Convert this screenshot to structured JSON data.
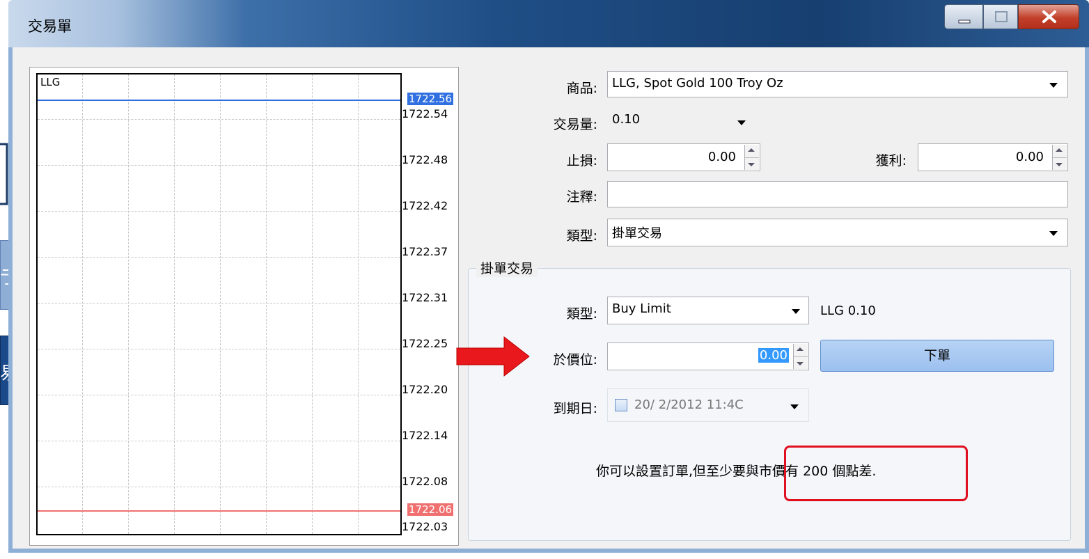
{
  "window": {
    "title": "交易單"
  },
  "slide_fragments": {
    "frag1": "亍",
    "frag2": "易"
  },
  "chart": {
    "symbol": "LLG",
    "ticks": [
      "1722.54",
      "1722.48",
      "1722.42",
      "1722.37",
      "1722.31",
      "1722.25",
      "1722.20",
      "1722.14",
      "1722.08",
      "1722.03"
    ],
    "ask_label": "1722.56",
    "bid_label": "1722.06",
    "ask_color": "#3070e0",
    "bid_color": "#f07070"
  },
  "form": {
    "symbol_label": "商品:",
    "symbol_value": "LLG, Spot Gold 100 Troy Oz",
    "volume_label": "交易量:",
    "volume_value": "0.10",
    "sl_label": "止損:",
    "sl_value": "0.00",
    "tp_label": "獲利:",
    "tp_value": "0.00",
    "comment_label": "注釋:",
    "comment_value": "",
    "type_label": "類型:",
    "type_value": "掛單交易"
  },
  "pending": {
    "group_title": "掛單交易",
    "type_label": "類型:",
    "type_value": "Buy Limit",
    "type_info": "LLG 0.10",
    "price_label": "於價位:",
    "price_value": "0.00",
    "place_button": "下單",
    "expiry_label": "到期日:",
    "expiry_value": "20/ 2/2012 11:4C",
    "note": "你可以設置訂單,但至少要與市價有 200 個點差."
  }
}
